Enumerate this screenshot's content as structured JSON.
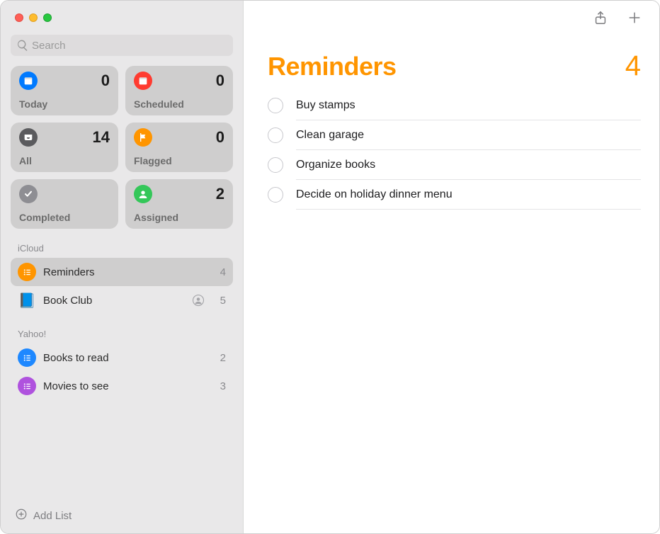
{
  "search": {
    "placeholder": "Search"
  },
  "smart": [
    {
      "label": "Today",
      "count": "0",
      "color": "bg-blue",
      "icon": "calendar-icon"
    },
    {
      "label": "Scheduled",
      "count": "0",
      "color": "bg-red",
      "icon": "calendar-icon"
    },
    {
      "label": "All",
      "count": "14",
      "color": "bg-dark",
      "icon": "tray-icon"
    },
    {
      "label": "Flagged",
      "count": "0",
      "color": "bg-orange",
      "icon": "flag-icon"
    },
    {
      "label": "Completed",
      "count": "",
      "color": "bg-gray",
      "icon": "check-icon"
    },
    {
      "label": "Assigned",
      "count": "2",
      "color": "bg-green",
      "icon": "person-icon"
    }
  ],
  "sections": [
    {
      "name": "iCloud",
      "lists": [
        {
          "name": "Reminders",
          "count": "4",
          "color": "bg-orange",
          "icon": "list-icon",
          "selected": true,
          "shared": false,
          "emoji": ""
        },
        {
          "name": "Book Club",
          "count": "5",
          "color": "",
          "icon": "",
          "selected": false,
          "shared": true,
          "emoji": "📘"
        }
      ]
    },
    {
      "name": "Yahoo!",
      "lists": [
        {
          "name": "Books to read",
          "count": "2",
          "color": "bg-blue2",
          "icon": "list-icon",
          "selected": false,
          "shared": false,
          "emoji": ""
        },
        {
          "name": "Movies to see",
          "count": "3",
          "color": "bg-purple",
          "icon": "list-icon",
          "selected": false,
          "shared": false,
          "emoji": ""
        }
      ]
    }
  ],
  "add_list_label": "Add List",
  "main": {
    "title": "Reminders",
    "count": "4",
    "items": [
      "Buy stamps",
      "Clean garage",
      "Organize books",
      "Decide on holiday dinner menu"
    ]
  }
}
